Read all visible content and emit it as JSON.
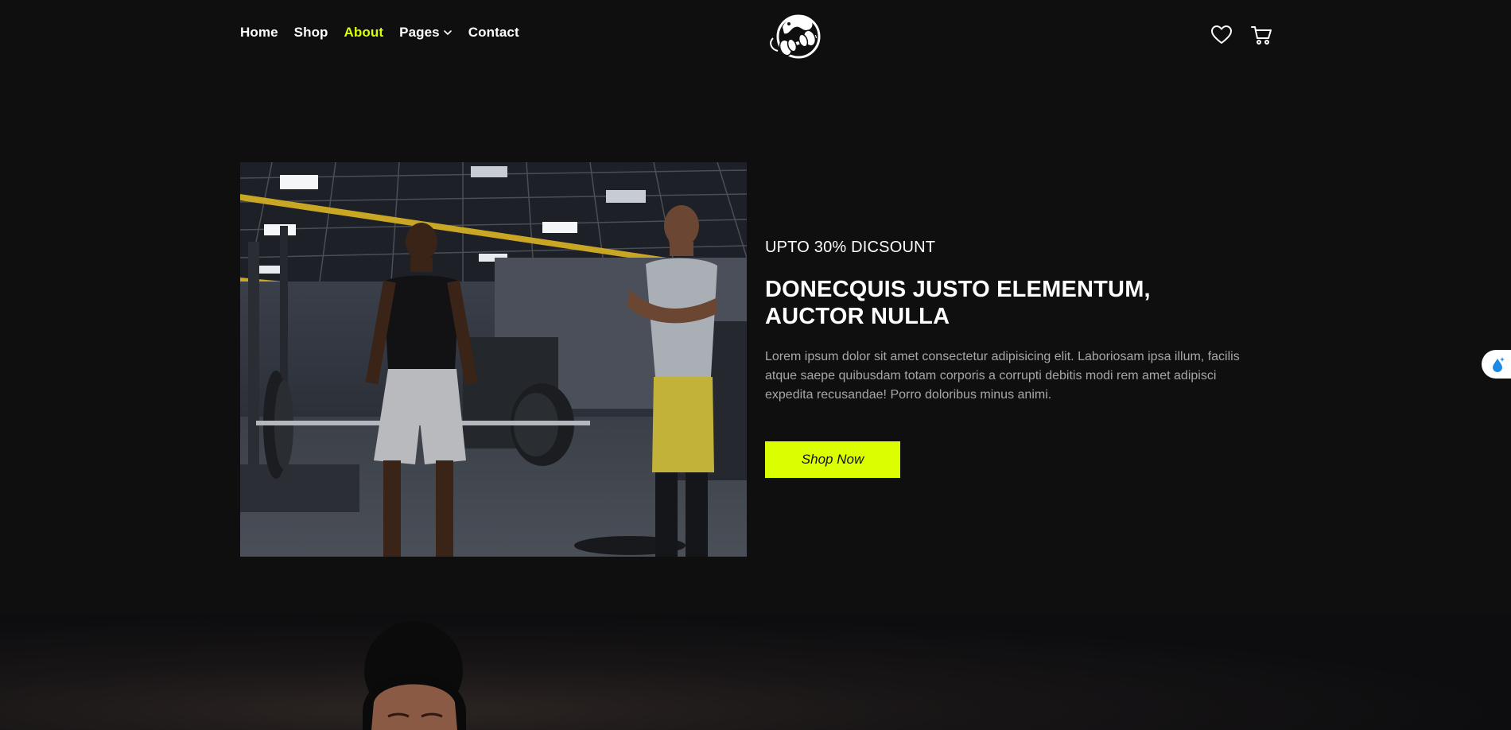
{
  "nav": {
    "items": [
      {
        "label": "Home",
        "active": false
      },
      {
        "label": "Shop",
        "active": false
      },
      {
        "label": "About",
        "active": true
      },
      {
        "label": "Pages",
        "active": false,
        "has_dropdown": true
      },
      {
        "label": "Contact",
        "active": false
      }
    ]
  },
  "header": {
    "logo_icon": "gym-dumbbell-logo-icon",
    "actions": [
      "heart-icon",
      "cart-icon"
    ]
  },
  "hero": {
    "subtitle": "UPTO 30% DICSOUNT",
    "title": "DONECQUIS JUSTO ELEMENTUM, AUCTOR NULLA",
    "description": "Lorem ipsum dolor sit amet consectetur adipisicing elit. Laboriosam ipsa illum, facilis atque saepe quibusdam totam corporis a corrupti debitis modi rem amet adipisci expedita recusandae! Porro doloribus minus animi.",
    "button_label": "Shop Now",
    "image": "gym-trainer-deadlift-photo"
  },
  "colors": {
    "background": "#0f0f0f",
    "accent": "#dcff00",
    "text": "#ffffff",
    "muted": "#a7a7a7"
  }
}
